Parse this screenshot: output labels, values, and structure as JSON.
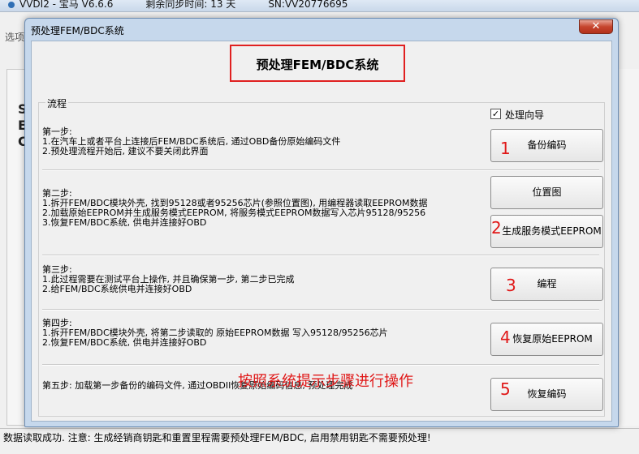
{
  "main_window": {
    "title_items": [
      "VVDI2 - 宝马 V6.6.6",
      "剩余同步时间: 13 天",
      "SN:VV20776695"
    ],
    "tab_label": "选项",
    "side_letters": [
      "S",
      "E",
      "C"
    ]
  },
  "status_bar": {
    "text": "数据读取成功. 注意: 生成经销商钥匙和重置里程需要预处理FEM/BDC, 启用禁用钥匙不需要预处理!"
  },
  "dialog": {
    "title": "预处理FEM/BDC系统",
    "close_label": "✕",
    "heading": "预处理FEM/BDC系统",
    "group_label": "流程",
    "wizard": {
      "checked": true,
      "label": "处理向导",
      "check_glyph": "✓"
    },
    "steps": [
      {
        "title": "第一步:",
        "lines": [
          "1.在汽车上或者平台上连接后FEM/BDC系统后, 通过OBD备份原始编码文件",
          "2.预处理流程开始后, 建议不要关闭此界面"
        ],
        "buttons": [
          {
            "label": "备份编码",
            "marker": "1"
          }
        ]
      },
      {
        "title": "第二步:",
        "lines": [
          "1.拆开FEM/BDC模块外壳, 找到95128或者95256芯片(参照位置图), 用编程器读取EEPROM数据",
          "2.加载原始EEPROM并生成服务模式EEPROM, 将服务模式EEPROM数据写入芯片95128/95256",
          "3.恢复FEM/BDC系统, 供电并连接好OBD"
        ],
        "buttons": [
          {
            "label": "位置图",
            "marker": ""
          },
          {
            "label": "生成服务模式EEPROM",
            "marker": "2"
          }
        ]
      },
      {
        "title": "第三步:",
        "lines": [
          "1.此过程需要在测试平台上操作, 并且确保第一步, 第二步已完成",
          "2.给FEM/BDC系统供电并连接好OBD"
        ],
        "buttons": [
          {
            "label": "编程",
            "marker": "3"
          }
        ]
      },
      {
        "title": "第四步:",
        "lines": [
          "1.拆开FEM/BDC模块外壳, 将第二步读取的 原始EEPROM数据 写入95128/95256芯片",
          "2.恢复FEM/BDC系统, 供电并连接好OBD"
        ],
        "buttons": [
          {
            "label": "恢复原始EEPROM",
            "marker": "4"
          }
        ]
      },
      {
        "title": "第五步: 加载第一步备份的编码文件, 通过OBDII恢复原始编码信息, 预处理完成",
        "lines": [],
        "buttons": [
          {
            "label": "恢复编码",
            "marker": "5"
          }
        ]
      }
    ],
    "hint": "按照系统提示步骤进行操作"
  },
  "colors": {
    "annotation_red": "#e01818",
    "dialog_frame": "#c6d8ec"
  }
}
